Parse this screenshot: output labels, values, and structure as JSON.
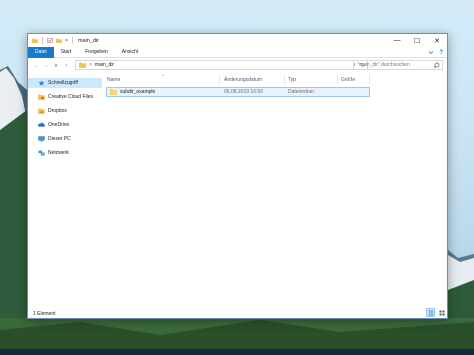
{
  "window": {
    "title": "main_dir",
    "quick_access_separator": "=",
    "controls": {
      "minimize": "—",
      "maximize": "☐",
      "close": "✕"
    }
  },
  "ribbon": {
    "tabs": [
      {
        "label": "Datei",
        "active": true
      },
      {
        "label": "Start",
        "active": false
      },
      {
        "label": "Freigeben",
        "active": false
      },
      {
        "label": "Ansicht",
        "active": false
      }
    ],
    "expand_icon": "chevron-down-icon",
    "help_label": "?"
  },
  "navigation": {
    "back": "←",
    "forward": "→",
    "recent": "∨",
    "up": "↑",
    "path_separator": ">",
    "path": "main_dir",
    "dropdown": "∨",
    "refresh": "↻",
    "search_placeholder": "\"main_dir\" durchsuchen"
  },
  "sidebar": {
    "items": [
      {
        "label": "Schnellzugriff",
        "icon": "star-icon",
        "selected": true
      },
      {
        "label": "Creative Cloud Files",
        "icon": "creative-cloud-icon",
        "selected": false
      },
      {
        "label": "Dropbox",
        "icon": "dropbox-icon",
        "selected": false
      },
      {
        "label": "OneDrive",
        "icon": "onedrive-icon",
        "selected": false
      },
      {
        "label": "Dieser PC",
        "icon": "pc-icon",
        "selected": false
      },
      {
        "label": "Netzwerk",
        "icon": "network-icon",
        "selected": false
      }
    ]
  },
  "file_list": {
    "columns": [
      "Name",
      "Änderungsdatum",
      "Typ",
      "Größe"
    ],
    "sort_indicator": "^",
    "rows": [
      {
        "name": "subdir_example",
        "modified": "05.08.2019 16:50",
        "type": "Dateiordner",
        "size": "",
        "icon": "folder-icon"
      }
    ]
  },
  "status": {
    "item_count": "1 Element"
  },
  "colors": {
    "accent": "#1979ca",
    "selection": "#cce8ff",
    "selection_border": "#99c9ef",
    "folder": "#f2c55c"
  }
}
